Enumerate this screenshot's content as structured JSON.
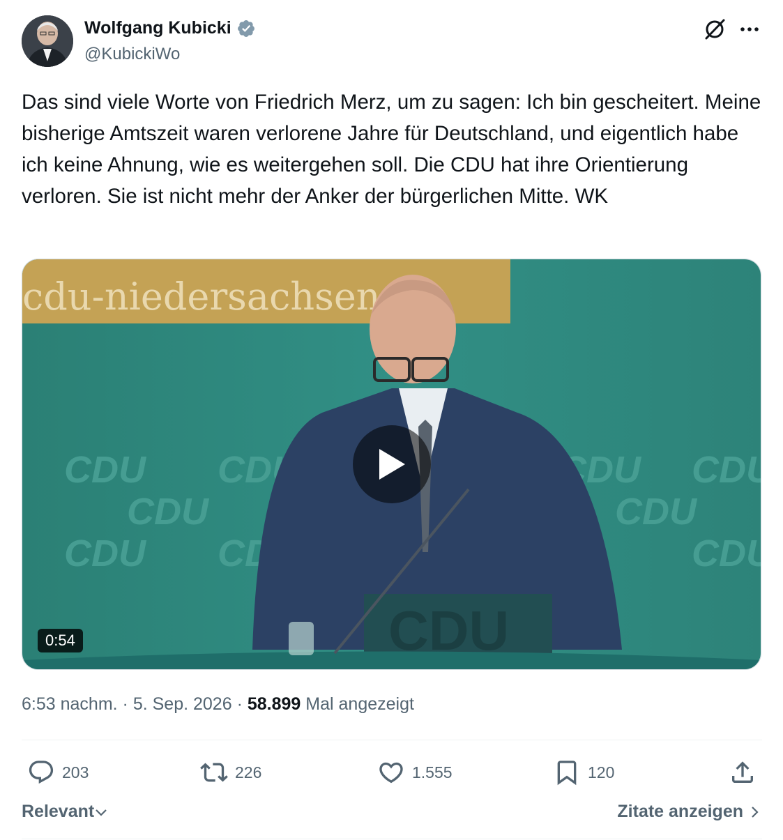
{
  "author": {
    "display_name": "Wolfgang Kubicki",
    "handle": "@KubickiWo",
    "verified": true
  },
  "tweet": {
    "text": "Das sind viele Worte von Friedrich Merz, um zu sagen: Ich bin gescheitert. Meine bisherige Amtszeit waren verlorene Jahre für Deutschland, und eigentlich habe ich keine Ahnung, wie es weitergehen soll. Die CDU hat ihre Orientierung verloren. Sie ist nicht mehr der Anker der bürgerlichen Mitte. WK"
  },
  "media": {
    "type": "video",
    "duration": "0:54",
    "banner_text": "cdu-niedersachsen.de",
    "backdrop_logo": "CDU"
  },
  "meta": {
    "time": "6:53 nachm.",
    "separator": "·",
    "date": "5. Sep. 2026",
    "views_count": "58.899",
    "views_label": "Mal angezeigt"
  },
  "actions": {
    "replies": "203",
    "reposts": "226",
    "likes": "1.555",
    "bookmarks": "120"
  },
  "footer": {
    "sort_label": "Relevant",
    "quotes_label": "Zitate anzeigen"
  },
  "icons": [
    "verified-badge-icon",
    "grok-icon",
    "more-icon",
    "play-icon",
    "reply-icon",
    "repost-icon",
    "like-icon",
    "bookmark-icon",
    "share-icon",
    "chevron-down-icon",
    "chevron-right-icon"
  ],
  "colors": {
    "text_primary": "#0f1419",
    "text_secondary": "#536471",
    "verified": "#829aab",
    "divider": "#eff3f4",
    "video_backdrop": "#2f8a80",
    "banner": "#c4a255"
  }
}
